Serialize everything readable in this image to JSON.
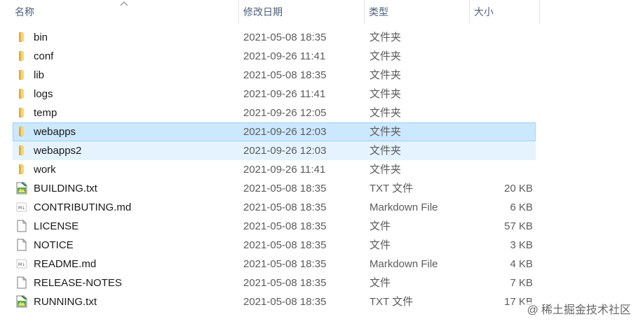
{
  "columns": {
    "name": "名称",
    "modified": "修改日期",
    "type": "类型",
    "size": "大小"
  },
  "sort_indicator": "chevron-up-icon",
  "colors": {
    "selected_bg": "#cce8ff",
    "selected_border": "#99d1ff",
    "hover_bg": "#e5f3ff",
    "folder": "#f8d775",
    "header_text": "#4c607a"
  },
  "rows": [
    {
      "name": "bin",
      "date": "2021-05-08 18:35",
      "type": "文件夹",
      "size": "",
      "icon": "folder-icon",
      "state": ""
    },
    {
      "name": "conf",
      "date": "2021-09-26 11:41",
      "type": "文件夹",
      "size": "",
      "icon": "folder-icon",
      "state": ""
    },
    {
      "name": "lib",
      "date": "2021-05-08 18:35",
      "type": "文件夹",
      "size": "",
      "icon": "folder-icon",
      "state": ""
    },
    {
      "name": "logs",
      "date": "2021-09-26 11:41",
      "type": "文件夹",
      "size": "",
      "icon": "folder-icon",
      "state": ""
    },
    {
      "name": "temp",
      "date": "2021-09-26 12:05",
      "type": "文件夹",
      "size": "",
      "icon": "folder-icon",
      "state": ""
    },
    {
      "name": "webapps",
      "date": "2021-09-26 12:03",
      "type": "文件夹",
      "size": "",
      "icon": "folder-icon",
      "state": "selected"
    },
    {
      "name": "webapps2",
      "date": "2021-09-26 12:03",
      "type": "文件夹",
      "size": "",
      "icon": "folder-icon",
      "state": "hover"
    },
    {
      "name": "work",
      "date": "2021-09-26 11:41",
      "type": "文件夹",
      "size": "",
      "icon": "folder-icon",
      "state": ""
    },
    {
      "name": "BUILDING.txt",
      "date": "2021-05-08 18:35",
      "type": "TXT 文件",
      "size": "20 KB",
      "icon": "text-file-icon",
      "state": ""
    },
    {
      "name": "CONTRIBUTING.md",
      "date": "2021-05-08 18:35",
      "type": "Markdown File",
      "size": "6 KB",
      "icon": "markdown-file-icon",
      "state": ""
    },
    {
      "name": "LICENSE",
      "date": "2021-05-08 18:35",
      "type": "文件",
      "size": "57 KB",
      "icon": "blank-file-icon",
      "state": ""
    },
    {
      "name": "NOTICE",
      "date": "2021-05-08 18:35",
      "type": "文件",
      "size": "3 KB",
      "icon": "blank-file-icon",
      "state": ""
    },
    {
      "name": "README.md",
      "date": "2021-05-08 18:35",
      "type": "Markdown File",
      "size": "4 KB",
      "icon": "markdown-file-icon",
      "state": ""
    },
    {
      "name": "RELEASE-NOTES",
      "date": "2021-05-08 18:35",
      "type": "文件",
      "size": "7 KB",
      "icon": "blank-file-icon",
      "state": ""
    },
    {
      "name": "RUNNING.txt",
      "date": "2021-05-08 18:35",
      "type": "TXT 文件",
      "size": "17 KB",
      "icon": "text-file-icon",
      "state": ""
    }
  ],
  "watermark": {
    "at": "@",
    "text": "稀土掘金技术社区"
  }
}
